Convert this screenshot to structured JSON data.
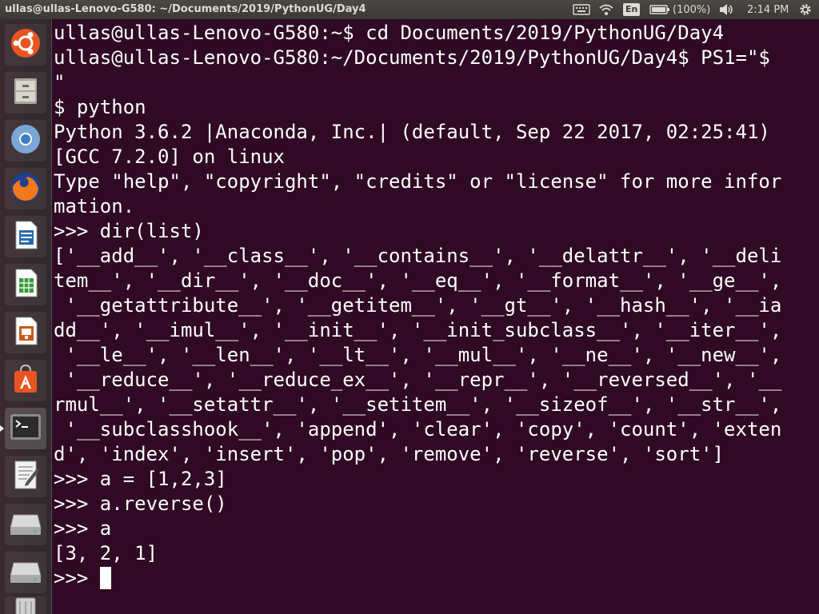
{
  "top_panel": {
    "window_title": "ullas@ullas-Lenovo-G580: ~/Documents/2019/PythonUG/Day4",
    "language": "En",
    "battery": "(100%)",
    "clock": "2:14 PM",
    "icons": [
      "keyboard-icon",
      "wifi-icon",
      "battery-icon",
      "volume-icon",
      "gear-icon"
    ]
  },
  "launcher": {
    "items": [
      {
        "name": "ubuntu-dash",
        "color": "#e95420"
      },
      {
        "name": "files",
        "color": "#9c9a92"
      },
      {
        "name": "chromium",
        "color": "#4a86c8"
      },
      {
        "name": "firefox",
        "color": "#e66000"
      },
      {
        "name": "libreoffice-writer",
        "color": "#2a6ab3"
      },
      {
        "name": "libreoffice-calc",
        "color": "#3b9a3b"
      },
      {
        "name": "libreoffice-impress",
        "color": "#c85a1e"
      },
      {
        "name": "ubuntu-software",
        "color": "#e95420"
      },
      {
        "name": "terminal",
        "color": "#2c2c2c"
      },
      {
        "name": "text-editor",
        "color": "#dddddd"
      },
      {
        "name": "disk-1",
        "color": "#bbbbbb"
      },
      {
        "name": "disk-2",
        "color": "#bbbbbb"
      },
      {
        "name": "trash",
        "color": "#cccccc"
      }
    ]
  },
  "terminal": {
    "lines": [
      "ullas@ullas-Lenovo-G580:~$ cd Documents/2019/PythonUG/Day4",
      "ullas@ullas-Lenovo-G580:~/Documents/2019/PythonUG/Day4$ PS1=\"$",
      "\"",
      "$ python",
      "Python 3.6.2 |Anaconda, Inc.| (default, Sep 22 2017, 02:25:41)",
      "[GCC 7.2.0] on linux",
      "Type \"help\", \"copyright\", \"credits\" or \"license\" for more infor",
      "mation.",
      ">>> dir(list)",
      "['__add__', '__class__', '__contains__', '__delattr__', '__deli",
      "tem__', '__dir__', '__doc__', '__eq__', '__format__', '__ge__',",
      " '__getattribute__', '__getitem__', '__gt__', '__hash__', '__ia",
      "dd__', '__imul__', '__init__', '__init_subclass__', '__iter__',",
      " '__le__', '__len__', '__lt__', '__mul__', '__ne__', '__new__',",
      " '__reduce__', '__reduce_ex__', '__repr__', '__reversed__', '__",
      "rmul__', '__setattr__', '__setitem__', '__sizeof__', '__str__',",
      " '__subclasshook__', 'append', 'clear', 'copy', 'count', 'exten",
      "d', 'index', 'insert', 'pop', 'remove', 'reverse', 'sort']",
      ">>> a = [1,2,3]",
      ">>> a.reverse()",
      ">>> a",
      "[3, 2, 1]"
    ],
    "prompt": ">>> "
  }
}
